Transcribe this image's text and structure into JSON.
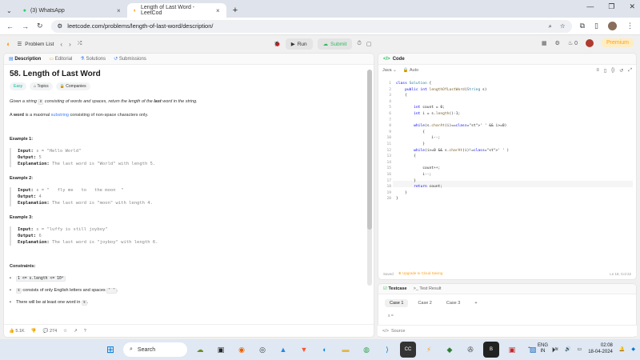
{
  "browser": {
    "tabs": [
      {
        "title": "(3) WhatsApp",
        "active": false
      },
      {
        "title": "Length of Last Word - LeetCod",
        "active": true
      }
    ],
    "url": "leetcode.com/problems/length-of-last-word/description/"
  },
  "lc_header": {
    "problem_list": "Problem List",
    "run": "Run",
    "submit": "Submit",
    "streak": "0",
    "premium": "Premium"
  },
  "left_tabs": [
    "Description",
    "Editorial",
    "Solutions",
    "Submissions"
  ],
  "problem": {
    "title": "58. Length of Last Word",
    "difficulty": "Easy",
    "topics": "Topics",
    "companies": "Companies",
    "desc_1": "Given a string",
    "desc_s": "s",
    "desc_2": "consisting of words and spaces, return the length of the",
    "desc_last": "last",
    "desc_3": "word in the string.",
    "word_def_b": "word",
    "word_def_1": "is a maximal",
    "word_def_link": "substring",
    "word_def_2": "consisting of non-space characters only.",
    "examples": [
      {
        "h": "Example 1:",
        "input": "s = \"Hello World\"",
        "output": "5",
        "explanation": "The last word is \"World\" with length 5."
      },
      {
        "h": "Example 2:",
        "input": "s = \"   fly me   to   the moon  \"",
        "output": "4",
        "explanation": "The last word is \"moon\" with length 4."
      },
      {
        "h": "Example 3:",
        "input": "s = \"luffy is still joyboy\"",
        "output": "6",
        "explanation": "The last word is \"joyboy\" with length 6."
      }
    ],
    "labels": {
      "input": "Input:",
      "output": "Output:",
      "explanation": "Explanation:"
    },
    "constraints_h": "Constraints:",
    "c1": "1 <= s.length <= 10⁴",
    "c2_code": "s",
    "c2": "consists of only English letters and spaces",
    "c2_code2": "' '",
    "c3": "There will be at least one word in",
    "c3_code": "s"
  },
  "left_footer": {
    "likes": "5.1K",
    "comments": "274"
  },
  "code_panel": {
    "title": "Code",
    "lang": "Java",
    "auto": "Auto",
    "saved": "Saved",
    "upgrade": "Upgrade to Cloud Saving",
    "position": "Ln 18, Col 22",
    "lines": [
      "class Solution {",
      "    public int lengthOfLastWord(String s)",
      "    {",
      "",
      "        int count = 0;",
      "        int i = s.length()-1;",
      "",
      "        while(s.charAt(i)==' ' && i>=0)",
      "            {",
      "                i--;",
      "            }",
      "        while(i>=0 && s.charAt(i)!=' ' )",
      "        {",
      "",
      "            count++;",
      "            i--;",
      "        }",
      "        return count;",
      "    }",
      "}"
    ]
  },
  "testcase": {
    "tab": "Testcase",
    "result": "Test Result",
    "cases": [
      "Case 1",
      "Case 2",
      "Case 3"
    ],
    "add": "+",
    "s_label": "s =",
    "source": "Source"
  },
  "taskbar": {
    "search": "Search",
    "lang": "ENG",
    "region": "IN",
    "time": "02:08",
    "date": "18-04-2024"
  }
}
